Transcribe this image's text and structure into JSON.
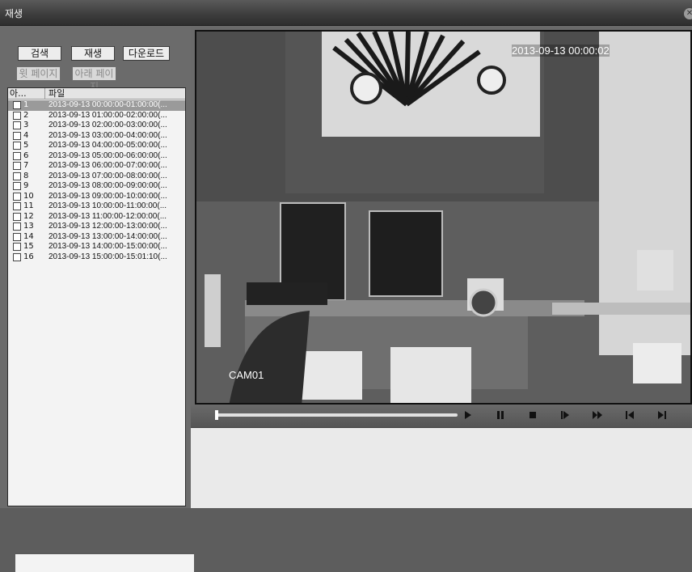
{
  "window": {
    "title": "재생"
  },
  "toolbar": {
    "search_label": "검색",
    "play_label": "재생",
    "download_label": "다운로드",
    "prev_page_label": "윗 페이지",
    "next_page_label": "아래 페이지"
  },
  "file_list": {
    "columns": {
      "no": "아...",
      "file": "파일"
    },
    "rows": [
      {
        "no": "1",
        "file": "2013-09-13 00:00:00-01:00:00(...",
        "selected": true
      },
      {
        "no": "2",
        "file": "2013-09-13 01:00:00-02:00:00(..."
      },
      {
        "no": "3",
        "file": "2013-09-13 02:00:00-03:00:00(..."
      },
      {
        "no": "4",
        "file": "2013-09-13 03:00:00-04:00:00(..."
      },
      {
        "no": "5",
        "file": "2013-09-13 04:00:00-05:00:00(..."
      },
      {
        "no": "6",
        "file": "2013-09-13 05:00:00-06:00:00(..."
      },
      {
        "no": "7",
        "file": "2013-09-13 06:00:00-07:00:00(..."
      },
      {
        "no": "8",
        "file": "2013-09-13 07:00:00-08:00:00(..."
      },
      {
        "no": "9",
        "file": "2013-09-13 08:00:00-09:00:00(..."
      },
      {
        "no": "10",
        "file": "2013-09-13 09:00:00-10:00:00(..."
      },
      {
        "no": "11",
        "file": "2013-09-13 10:00:00-11:00:00(..."
      },
      {
        "no": "12",
        "file": "2013-09-13 11:00:00-12:00:00(..."
      },
      {
        "no": "13",
        "file": "2013-09-13 12:00:00-13:00:00(..."
      },
      {
        "no": "14",
        "file": "2013-09-13 13:00:00-14:00:00(..."
      },
      {
        "no": "15",
        "file": "2013-09-13 14:00:00-15:00:00(..."
      },
      {
        "no": "16",
        "file": "2013-09-13 15:00:00-15:01:10(..."
      }
    ]
  },
  "video": {
    "timestamp": "2013-09-13 00:00:02",
    "camera": "CAM01"
  },
  "playback": {
    "progress": 0.0,
    "buttons": [
      "play-icon",
      "pause-icon",
      "stop-icon",
      "slow-icon",
      "fast-forward-icon",
      "prev-frame-icon",
      "next-frame-icon"
    ]
  }
}
